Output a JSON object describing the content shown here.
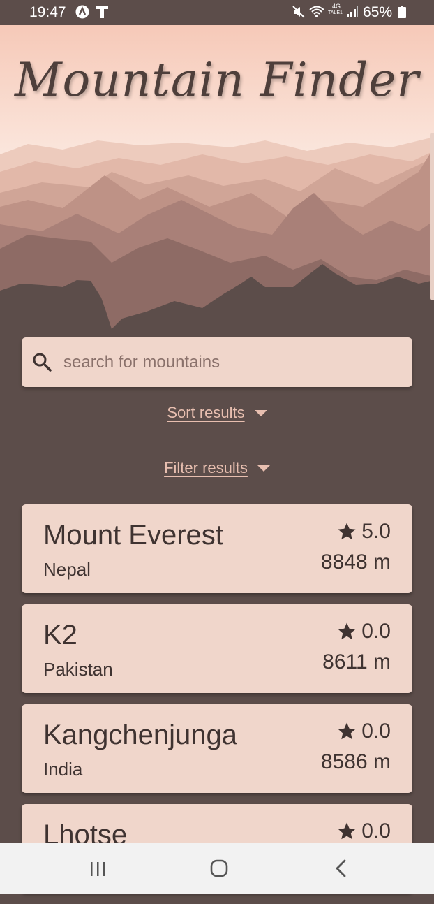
{
  "status_bar": {
    "time": "19:47",
    "network_label": "4G",
    "network_sub": "TALE1",
    "battery": "65%",
    "icons": [
      "app-notification-icon",
      "text-app-icon",
      "mute-icon",
      "wifi-icon",
      "signal-icon",
      "battery-icon"
    ]
  },
  "header": {
    "title": "Mountain Finder"
  },
  "search": {
    "placeholder": "search for mountains",
    "value": ""
  },
  "controls": {
    "sort_label": "Sort results",
    "filter_label": "Filter results"
  },
  "mountains": [
    {
      "name": "Mount Everest",
      "country": "Nepal",
      "rating": "5.0",
      "height": "8848 m"
    },
    {
      "name": "K2",
      "country": "Pakistan",
      "rating": "0.0",
      "height": "8611 m"
    },
    {
      "name": "Kangchenjunga",
      "country": "India",
      "rating": "0.0",
      "height": "8586 m"
    },
    {
      "name": "Lhotse",
      "country": "",
      "rating": "0.0",
      "height": ""
    }
  ],
  "colors": {
    "background": "#5c4d4a",
    "card": "#f0d6cb",
    "text": "#3f3331",
    "link": "#e8bfb0"
  },
  "nav_bar": {
    "buttons": [
      "recents-button",
      "home-button",
      "back-button"
    ]
  }
}
